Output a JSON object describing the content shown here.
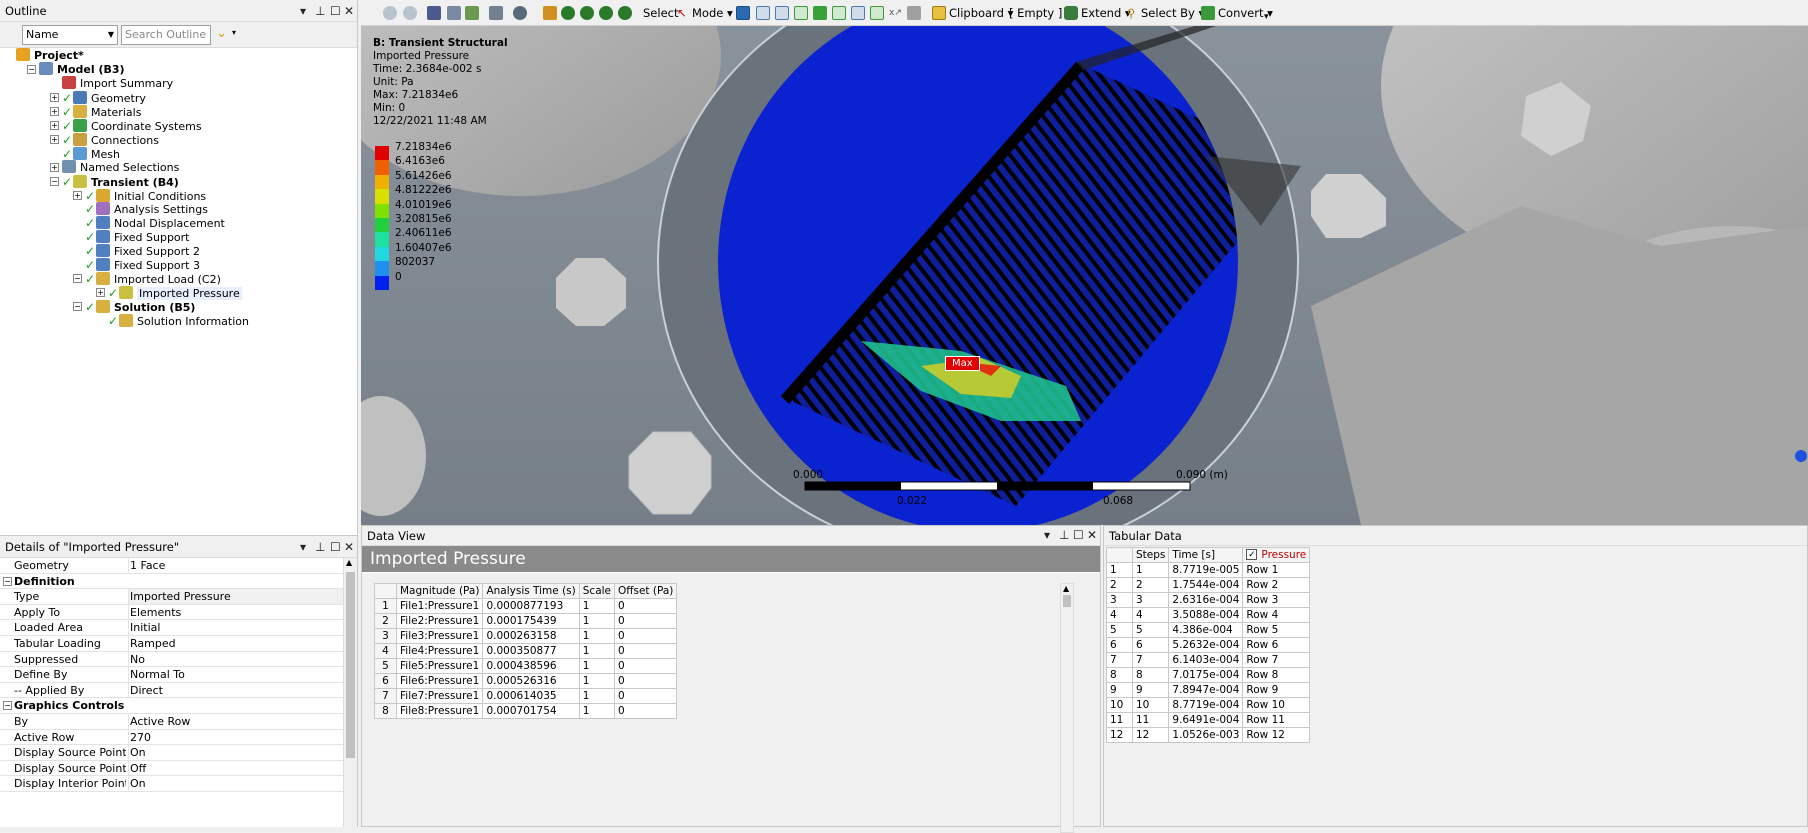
{
  "outline": {
    "title": "Outline",
    "filter_select": "Name",
    "search_placeholder": "Search Outline",
    "tree": [
      {
        "label": "Project*",
        "depth": 0,
        "bold": true,
        "check": false,
        "exp": "",
        "icon": "#e8a020"
      },
      {
        "label": "Model (B3)",
        "depth": 1,
        "bold": true,
        "check": false,
        "exp": "−",
        "icon": "#6a8cba"
      },
      {
        "label": "Import Summary",
        "depth": 2,
        "bold": false,
        "check": false,
        "exp": "",
        "icon": "#c84040"
      },
      {
        "label": "Geometry",
        "depth": 2,
        "bold": false,
        "check": true,
        "exp": "+",
        "icon": "#4a7ab8"
      },
      {
        "label": "Materials",
        "depth": 2,
        "bold": false,
        "check": true,
        "exp": "+",
        "icon": "#d8b040"
      },
      {
        "label": "Coordinate Systems",
        "depth": 2,
        "bold": false,
        "check": true,
        "exp": "+",
        "icon": "#3aa04a"
      },
      {
        "label": "Connections",
        "depth": 2,
        "bold": false,
        "check": true,
        "exp": "+",
        "icon": "#c8a040"
      },
      {
        "label": "Mesh",
        "depth": 2,
        "bold": false,
        "check": true,
        "exp": "",
        "icon": "#5a9ad0"
      },
      {
        "label": "Named Selections",
        "depth": 2,
        "bold": false,
        "check": false,
        "exp": "+",
        "icon": "#7090b0"
      },
      {
        "label": "Transient (B4)",
        "depth": 2,
        "bold": true,
        "check": true,
        "exp": "−",
        "icon": "#c8c040"
      },
      {
        "label": "Initial Conditions",
        "depth": 3,
        "bold": false,
        "check": true,
        "exp": "+",
        "icon": "#d8a830"
      },
      {
        "label": "Analysis Settings",
        "depth": 3,
        "bold": false,
        "check": true,
        "exp": "",
        "icon": "#a070c0"
      },
      {
        "label": "Nodal Displacement",
        "depth": 3,
        "bold": false,
        "check": true,
        "exp": "",
        "icon": "#5080c0"
      },
      {
        "label": "Fixed Support",
        "depth": 3,
        "bold": false,
        "check": true,
        "exp": "",
        "icon": "#5080c0"
      },
      {
        "label": "Fixed Support 2",
        "depth": 3,
        "bold": false,
        "check": true,
        "exp": "",
        "icon": "#5080c0"
      },
      {
        "label": "Fixed Support 3",
        "depth": 3,
        "bold": false,
        "check": true,
        "exp": "",
        "icon": "#5080c0"
      },
      {
        "label": "Imported Load (C2)",
        "depth": 3,
        "bold": false,
        "check": true,
        "exp": "−",
        "icon": "#d8b040"
      },
      {
        "label": "Imported Pressure",
        "depth": 4,
        "bold": false,
        "check": true,
        "exp": "+",
        "icon": "#c8c040",
        "selected": true
      },
      {
        "label": "Solution (B5)",
        "depth": 3,
        "bold": true,
        "check": true,
        "exp": "−",
        "icon": "#d8b040"
      },
      {
        "label": "Solution Information",
        "depth": 4,
        "bold": false,
        "check": true,
        "exp": "",
        "icon": "#d8b040"
      }
    ]
  },
  "details": {
    "title": "Details of \"Imported Pressure\"",
    "rows": [
      {
        "key": "Geometry",
        "value": "1 Face",
        "type": "row"
      },
      {
        "key": "Definition",
        "value": "",
        "type": "cat"
      },
      {
        "key": "Type",
        "value": "Imported Pressure",
        "type": "row",
        "sel": true
      },
      {
        "key": "Apply To",
        "value": "Elements",
        "type": "row"
      },
      {
        "key": "Loaded Area",
        "value": "Initial",
        "type": "row"
      },
      {
        "key": "Tabular Loading",
        "value": "Ramped",
        "type": "row"
      },
      {
        "key": "Suppressed",
        "value": "No",
        "type": "row"
      },
      {
        "key": "Define By",
        "value": "Normal To",
        "type": "row"
      },
      {
        "key": "-- Applied By",
        "value": "Direct",
        "type": "row"
      },
      {
        "key": "Graphics Controls",
        "value": "",
        "type": "cat"
      },
      {
        "key": "By",
        "value": "Active Row",
        "type": "row"
      },
      {
        "key": "Active Row",
        "value": "270",
        "type": "row"
      },
      {
        "key": "Display Source Points",
        "value": "On",
        "type": "row"
      },
      {
        "key": "Display Source Point Ids",
        "value": "Off",
        "type": "row"
      },
      {
        "key": "Display Interior Points",
        "value": "On",
        "type": "row"
      }
    ]
  },
  "toolbar": {
    "select": "Select",
    "mode": "Mode",
    "clipboard": "Clipboard",
    "empty": "[ Empty ]",
    "extend": "Extend",
    "select_by": "Select By",
    "convert": "Convert"
  },
  "viewport": {
    "legend": {
      "title": "B: Transient Structural",
      "subtitle": "Imported Pressure",
      "time": "Time: 2.3684e-002 s",
      "unit": "Unit: Pa",
      "max": "Max: 7.21834e6",
      "min": "Min: 0",
      "date": "12/22/2021 11:48 AM",
      "bands": [
        {
          "label": "7.21834e6",
          "color": "#e00000"
        },
        {
          "label": "6.4163e6",
          "color": "#f06000"
        },
        {
          "label": "5.61426e6",
          "color": "#f0b000"
        },
        {
          "label": "4.81222e6",
          "color": "#d8e000"
        },
        {
          "label": "4.01019e6",
          "color": "#80e000"
        },
        {
          "label": "3.20815e6",
          "color": "#20d040"
        },
        {
          "label": "2.40611e6",
          "color": "#20e0a0"
        },
        {
          "label": "1.60407e6",
          "color": "#20d8e0"
        },
        {
          "label": "802037",
          "color": "#2090f0"
        },
        {
          "label": "0",
          "color": "#0020f0"
        }
      ]
    },
    "max_tag": "Max",
    "scale": {
      "t0": "0.000",
      "t1": "0.022",
      "t2": "0.068",
      "t3": "0.090 (m)"
    }
  },
  "dataview": {
    "title": "Data View",
    "heading": "Imported Pressure",
    "columns": [
      "",
      "Magnitude (Pa)",
      "Analysis Time (s)",
      "Scale",
      "Offset (Pa)"
    ],
    "rows": [
      [
        "1",
        "File1:Pressure1",
        "0.0000877193",
        "1",
        "0"
      ],
      [
        "2",
        "File2:Pressure1",
        "0.000175439",
        "1",
        "0"
      ],
      [
        "3",
        "File3:Pressure1",
        "0.000263158",
        "1",
        "0"
      ],
      [
        "4",
        "File4:Pressure1",
        "0.000350877",
        "1",
        "0"
      ],
      [
        "5",
        "File5:Pressure1",
        "0.000438596",
        "1",
        "0"
      ],
      [
        "6",
        "File6:Pressure1",
        "0.000526316",
        "1",
        "0"
      ],
      [
        "7",
        "File7:Pressure1",
        "0.000614035",
        "1",
        "0"
      ],
      [
        "8",
        "File8:Pressure1",
        "0.000701754",
        "1",
        "0"
      ]
    ]
  },
  "tabular": {
    "title": "Tabular Data",
    "columns": [
      "",
      "Steps",
      "Time [s]",
      "Pressure"
    ],
    "rows": [
      [
        "1",
        "1",
        "8.7719e-005",
        "Row 1"
      ],
      [
        "2",
        "2",
        "1.7544e-004",
        "Row 2"
      ],
      [
        "3",
        "3",
        "2.6316e-004",
        "Row 3"
      ],
      [
        "4",
        "4",
        "3.5088e-004",
        "Row 4"
      ],
      [
        "5",
        "5",
        "4.386e-004",
        "Row 5"
      ],
      [
        "6",
        "6",
        "5.2632e-004",
        "Row 6"
      ],
      [
        "7",
        "7",
        "6.1403e-004",
        "Row 7"
      ],
      [
        "8",
        "8",
        "7.0175e-004",
        "Row 8"
      ],
      [
        "9",
        "9",
        "7.8947e-004",
        "Row 9"
      ],
      [
        "10",
        "10",
        "8.7719e-004",
        "Row 10"
      ],
      [
        "11",
        "11",
        "9.6491e-004",
        "Row 11"
      ],
      [
        "12",
        "12",
        "1.0526e-003",
        "Row 12"
      ]
    ]
  }
}
